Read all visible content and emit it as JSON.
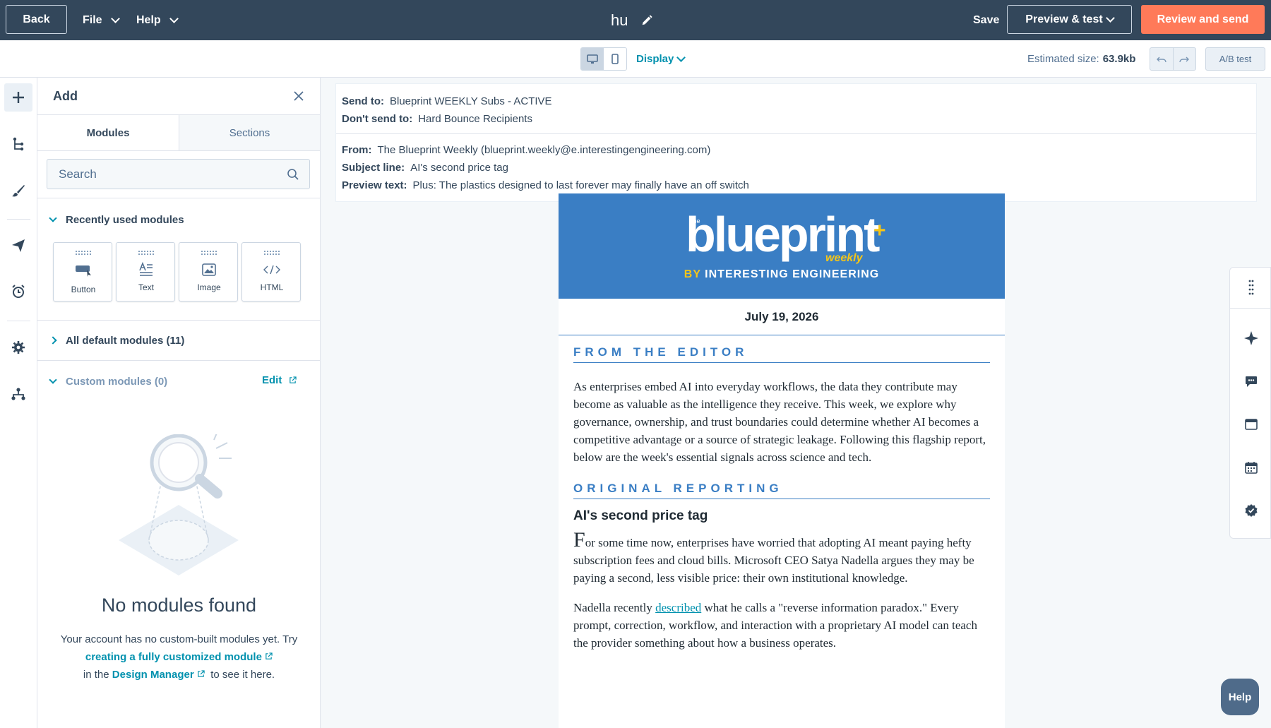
{
  "topbar": {
    "back_label": "Back",
    "file_label": "File",
    "help_label": "Help",
    "doc_title": "hu",
    "save_label": "Save",
    "preview_label": "Preview & test",
    "review_label": "Review and send"
  },
  "subbar": {
    "display_label": "Display",
    "estimated_size_label": "Estimated size:",
    "estimated_size_value": "63.9kb",
    "ab_test_label": "A/B test"
  },
  "panel": {
    "title": "Add",
    "tabs": [
      {
        "label": "Modules"
      },
      {
        "label": "Sections"
      }
    ],
    "search_placeholder": "Search",
    "recently_used_label": "Recently used modules",
    "modules": [
      {
        "label": "Button"
      },
      {
        "label": "Text"
      },
      {
        "label": "Image"
      },
      {
        "label": "HTML"
      }
    ],
    "all_default_label": "All default modules (11)",
    "custom_label": "Custom modules (0)",
    "edit_label": "Edit",
    "empty_title": "No modules found",
    "empty_text_1": "Your account has no custom-built modules yet. Try",
    "empty_link_1": "creating a fully customized module",
    "empty_text_2": "in the",
    "empty_link_2": "Design Manager",
    "empty_text_3": "to see it here."
  },
  "meta": {
    "send_to_label": "Send to:",
    "send_to_value": "Blueprint WEEKLY Subs - ACTIVE",
    "dont_send_label": "Don't send to:",
    "dont_send_value": "Hard Bounce Recipients",
    "from_label": "From:",
    "from_value": "The Blueprint Weekly (blueprint.weekly@e.interestingengineering.com)",
    "subject_label": "Subject line:",
    "subject_value": "AI's second price tag",
    "preview_label": "Preview text:",
    "preview_value": "Plus: The plastics designed to last forever may finally have an off switch"
  },
  "email": {
    "logo_the": "the",
    "logo_main": "blueprint",
    "logo_plus": "+",
    "logo_weekly": "weekly",
    "logo_by": "BY",
    "logo_org": "INTERESTING ENGINEERING",
    "date": "July 19, 2026",
    "editor_heading": "FROM THE EDITOR",
    "editor_para": "As enterprises embed AI into everyday workflows, the data they contribute may become as valuable as the intelligence they receive. This week, we explore why governance, ownership, and trust boundaries could determine whether AI becomes a competitive advantage or a source of strategic leakage. Following this flagship report, below are the week's essential signals across science and tech.",
    "reporting_heading": "ORIGINAL REPORTING",
    "article_title": "AI's second price tag",
    "article_dropcap": "F",
    "article_para_1": "or some time now, enterprises have worried that adopting AI meant paying hefty subscription fees and cloud bills. Microsoft CEO Satya Nadella argues they may be paying a second, less visible price: their own institutional knowledge.",
    "article_para_2_a": "Nadella recently",
    "article_para_2_link": "described",
    "article_para_2_b": "what he calls a \"reverse information paradox.\" Every prompt, correction, workflow, and interaction with a proprietary AI model can teach the provider something about how a business operates."
  },
  "help_button": "Help",
  "colors": {
    "topbar": "#33475b",
    "accent": "#ff7a59",
    "link": "#0091ae",
    "email_blue": "#3a7ec4",
    "logo_yellow": "#f5c518"
  }
}
